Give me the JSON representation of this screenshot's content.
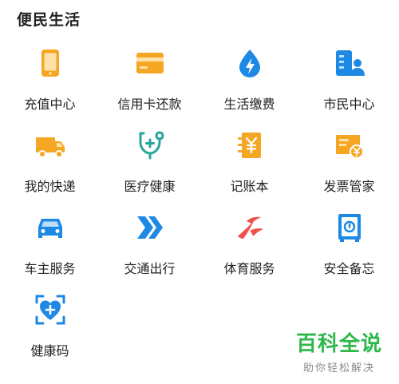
{
  "section": {
    "title": "便民生活"
  },
  "items": [
    {
      "label": "充值中心",
      "icon": "phone-icon",
      "color": "#f5a623"
    },
    {
      "label": "信用卡还款",
      "icon": "credit-card-icon",
      "color": "#f5a623"
    },
    {
      "label": "生活缴费",
      "icon": "water-drop-bolt-icon",
      "color": "#1e88e5"
    },
    {
      "label": "市民中心",
      "icon": "citizen-center-icon",
      "color": "#1e88e5"
    },
    {
      "label": "我的快递",
      "icon": "truck-icon",
      "color": "#f5a623"
    },
    {
      "label": "医疗健康",
      "icon": "stethoscope-icon",
      "color": "#26a69a"
    },
    {
      "label": "记账本",
      "icon": "ledger-yuan-icon",
      "color": "#f5a623"
    },
    {
      "label": "发票管家",
      "icon": "invoice-yuan-icon",
      "color": "#f5a623"
    },
    {
      "label": "车主服务",
      "icon": "car-icon",
      "color": "#1e88e5"
    },
    {
      "label": "交通出行",
      "icon": "double-chevron-icon",
      "color": "#1e88e5"
    },
    {
      "label": "体育服务",
      "icon": "sports-swoosh-icon",
      "color": "#ef5350"
    },
    {
      "label": "安全备忘",
      "icon": "safe-icon",
      "color": "#1e88e5"
    },
    {
      "label": "健康码",
      "icon": "health-code-heart-icon",
      "color": "#1e88e5"
    }
  ],
  "watermark": {
    "main": "百科全说",
    "sub": "助你轻松解决"
  }
}
